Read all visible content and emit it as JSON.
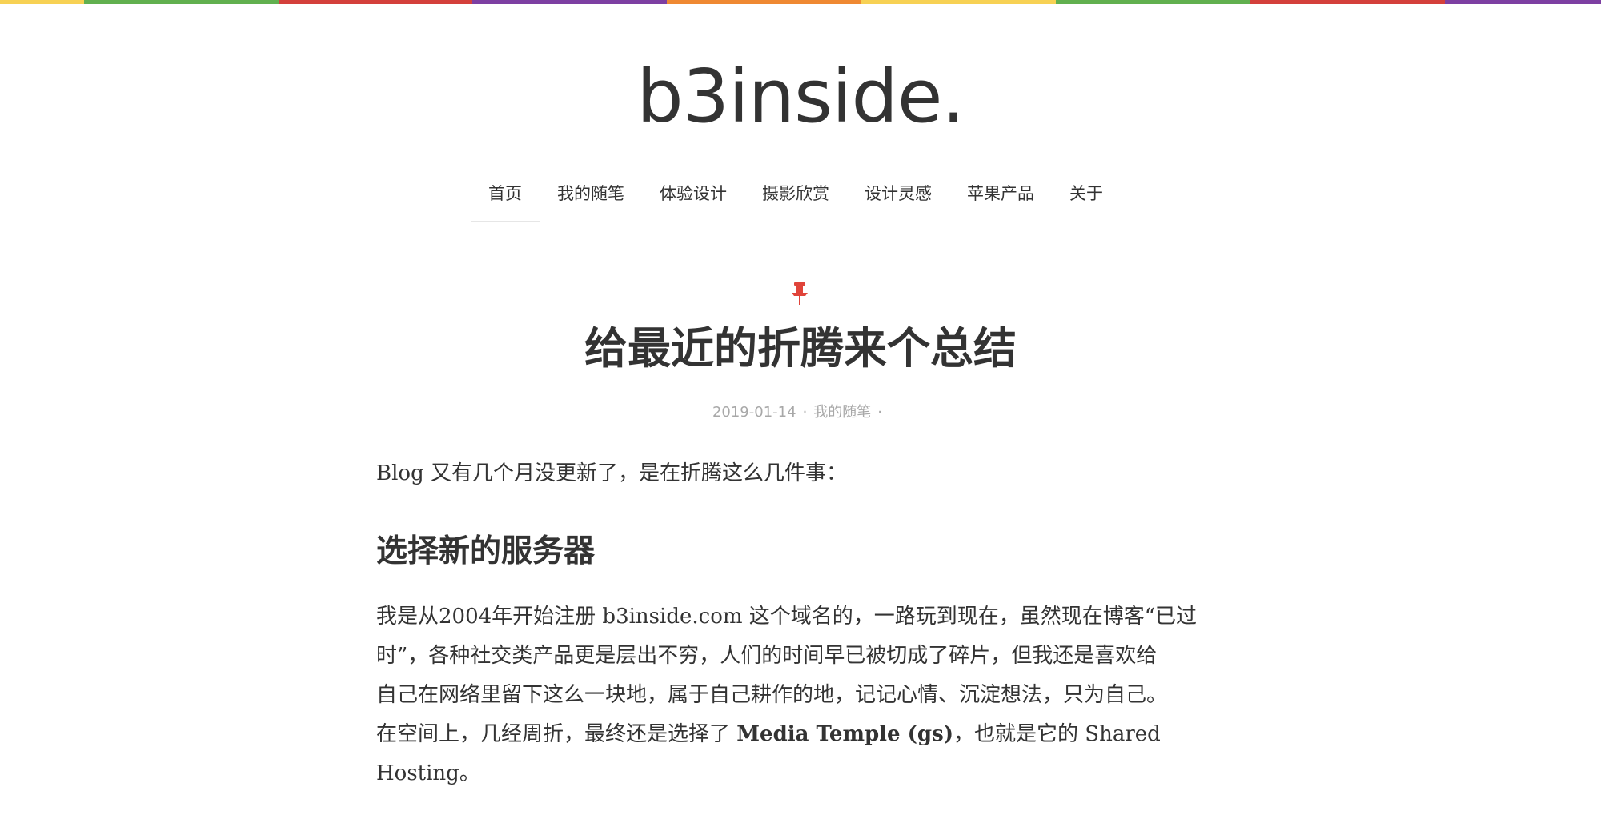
{
  "rainbow_colors": [
    "#f7d154",
    "#61b04f",
    "#d4403b",
    "#7d3fa2",
    "#ef8932",
    "#f7d154",
    "#61b04f",
    "#d4403b",
    "#7d3fa2"
  ],
  "site": {
    "logo": "b3inside."
  },
  "nav": {
    "items": [
      {
        "label": "首页",
        "active": true
      },
      {
        "label": "我的随笔"
      },
      {
        "label": "体验设计"
      },
      {
        "label": "摄影欣赏"
      },
      {
        "label": "设计灵感"
      },
      {
        "label": "苹果产品"
      },
      {
        "label": "关于"
      }
    ]
  },
  "post": {
    "pin_icon": "pushpin-icon",
    "pin_color": "#e0443a",
    "title": "给最近的折腾来个总结",
    "meta": {
      "date": "2019-01-14",
      "separator": "·",
      "category": "我的随笔"
    },
    "intro": "Blog 又有几个月没更新了，是在折腾这么几件事：",
    "section_heading": "选择新的服务器",
    "paragraph": {
      "line1": "我是从2004年开始注册 b3inside.com 这个域名的，一路玩到现在，虽然现在博客“已过",
      "line2": "时”，各种社交类产品更是层出不穷，人们的时间早已被切成了碎片，但我还是喜欢给",
      "line3": "自己在网络里留下这么一块地，属于自己耕作的地，记记心情、沉淀想法，只为自己。",
      "line4_before": "在空间上，几经周折，最终还是选择了 ",
      "line4_bold": "Media Temple (gs)",
      "line4_after": "，也就是它的 Shared",
      "line5": "Hosting。"
    }
  }
}
